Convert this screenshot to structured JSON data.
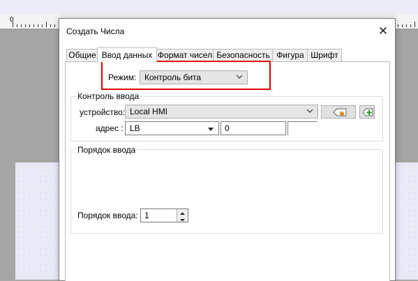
{
  "ruler": {
    "zero_label": "0"
  },
  "dialog": {
    "title": "Создать Числа",
    "close_symbol": "✕"
  },
  "tabs": [
    {
      "label": "Общие"
    },
    {
      "label": "Ввод данных"
    },
    {
      "label": "Формат чисел"
    },
    {
      "label": "Безопасность"
    },
    {
      "label": "Фигура"
    },
    {
      "label": "Шрифт"
    }
  ],
  "mode": {
    "label": "Режим:",
    "value": "Контроль бита"
  },
  "input_control": {
    "group_title": "Контроль ввода",
    "device_label": "устройство:",
    "device_value": "Local HMI",
    "address_label": "адрес :",
    "address_type": "LB",
    "address_value": "0"
  },
  "input_order": {
    "group_title": "Порядок ввода",
    "order_label": "Порядок ввода:",
    "order_value": "1"
  },
  "colors": {
    "highlight": "#e10000",
    "canvas": "#e9e9f7"
  }
}
